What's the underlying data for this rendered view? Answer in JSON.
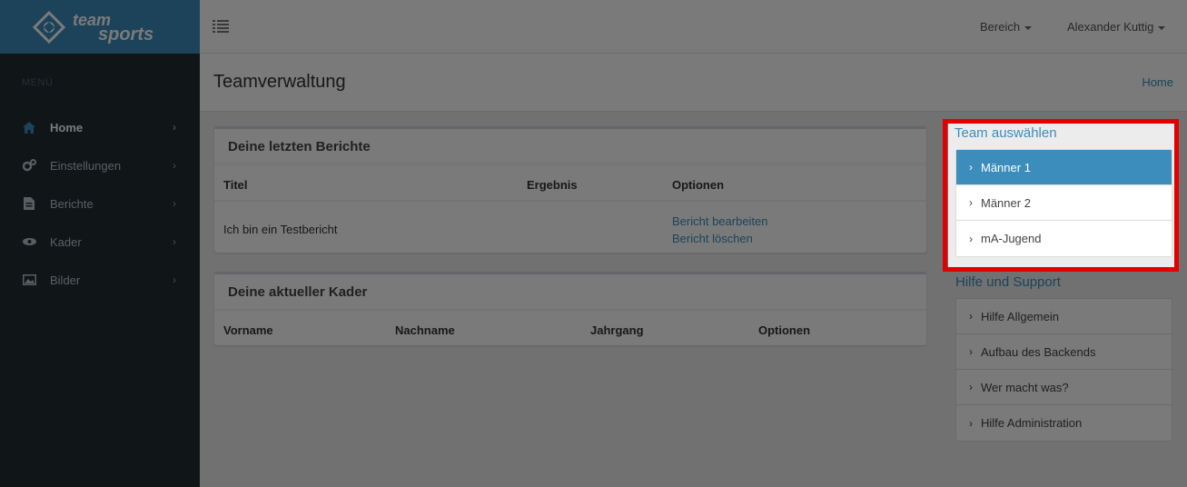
{
  "brand": {
    "line1": "team",
    "line2": "sports"
  },
  "sidebar": {
    "header": "MENÜ",
    "items": [
      {
        "label": "Home",
        "icon": "home-icon"
      },
      {
        "label": "Einstellungen",
        "icon": "gears-icon"
      },
      {
        "label": "Berichte",
        "icon": "document-icon"
      },
      {
        "label": "Kader",
        "icon": "eye-icon"
      },
      {
        "label": "Bilder",
        "icon": "image-icon"
      }
    ]
  },
  "topbar": {
    "section": "Bereich",
    "user": "Alexander Kuttig"
  },
  "page": {
    "title": "Teamverwaltung",
    "breadcrumb": "Home"
  },
  "reports_box": {
    "title": "Deine letzten Berichte",
    "columns": [
      "Titel",
      "Ergebnis",
      "Optionen"
    ],
    "rows": [
      {
        "title": "Ich bin ein Testbericht",
        "result": "",
        "edit": "Bericht bearbeiten",
        "delete": "Bericht löschen"
      }
    ]
  },
  "squad_box": {
    "title": "Deine aktueller Kader",
    "columns": [
      "Vorname",
      "Nachname",
      "Jahrgang",
      "Optionen"
    ]
  },
  "team_select": {
    "title": "Team auswählen",
    "items": [
      "Männer 1",
      "Männer 2",
      "mA-Jugend"
    ]
  },
  "help": {
    "title": "Hilfe und Support",
    "items": [
      "Hilfe Allgemein",
      "Aufbau des Backends",
      "Wer macht was?",
      "Hilfe Administration"
    ]
  },
  "colors": {
    "brand": "#3c8dbc",
    "sidebar": "#222d32",
    "highlight": "#e00000"
  }
}
